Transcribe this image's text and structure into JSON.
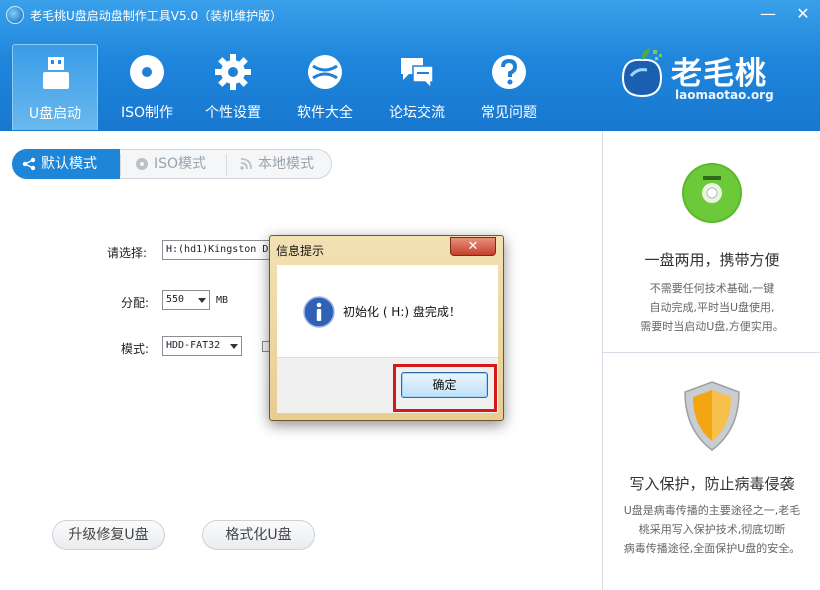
{
  "window": {
    "title": "老毛桃U盘启动盘制作工具V5.0（装机维护版）",
    "minimize_glyph": "—",
    "close_glyph": "✕"
  },
  "nav": {
    "items": [
      {
        "label": "U盘启动",
        "icon": "usb-drive-icon",
        "active": true
      },
      {
        "label": "ISO制作",
        "icon": "disc-icon",
        "active": false
      },
      {
        "label": "个性设置",
        "icon": "gear-icon",
        "active": false
      },
      {
        "label": "软件大全",
        "icon": "globe-icon",
        "active": false
      },
      {
        "label": "论坛交流",
        "icon": "chat-bubbles-icon",
        "active": false
      },
      {
        "label": "常见问题",
        "icon": "help-icon",
        "active": false
      }
    ]
  },
  "brand": {
    "name": "老毛桃",
    "url": "laomaotao.org"
  },
  "mode_tabs": [
    {
      "label": "默认模式",
      "icon": "share-icon",
      "active": true
    },
    {
      "label": "ISO模式",
      "icon": "disc-icon",
      "active": false
    },
    {
      "label": "本地模式",
      "icon": "rss-icon",
      "active": false
    }
  ],
  "form": {
    "select_label": "请选择:",
    "device_value": "H:(hd1)Kingston D",
    "alloc_label": "分配:",
    "alloc_value": "550",
    "alloc_unit": "MB",
    "mode_label": "模式:",
    "mode_value": "HDD-FAT32"
  },
  "buttons": {
    "repair": "升级修复U盘",
    "format": "格式化U盘"
  },
  "features": [
    {
      "title": "一盘两用，携带方便",
      "desc": [
        "不需要任何技术基础,一键",
        "自动完成,平时当U盘使用,",
        "需要时当启动U盘,方便实用。"
      ],
      "icon": "cd-icon"
    },
    {
      "title": "写入保护，防止病毒侵袭",
      "desc": [
        "U盘是病毒传播的主要途径之一,老毛",
        "桃采用写入保护技术,彻底切断",
        "病毒传播途径,全面保护U盘的安全。"
      ],
      "icon": "shield-icon"
    }
  ],
  "dialog": {
    "title": "信息提示",
    "message": "初始化 ( H:) 盘完成！",
    "ok_label": "确定",
    "close_glyph": "✕"
  },
  "colors": {
    "header_blue": "#1f86dc",
    "active_tab_blue": "#1e86d8",
    "highlight_red": "#d21a1a"
  }
}
